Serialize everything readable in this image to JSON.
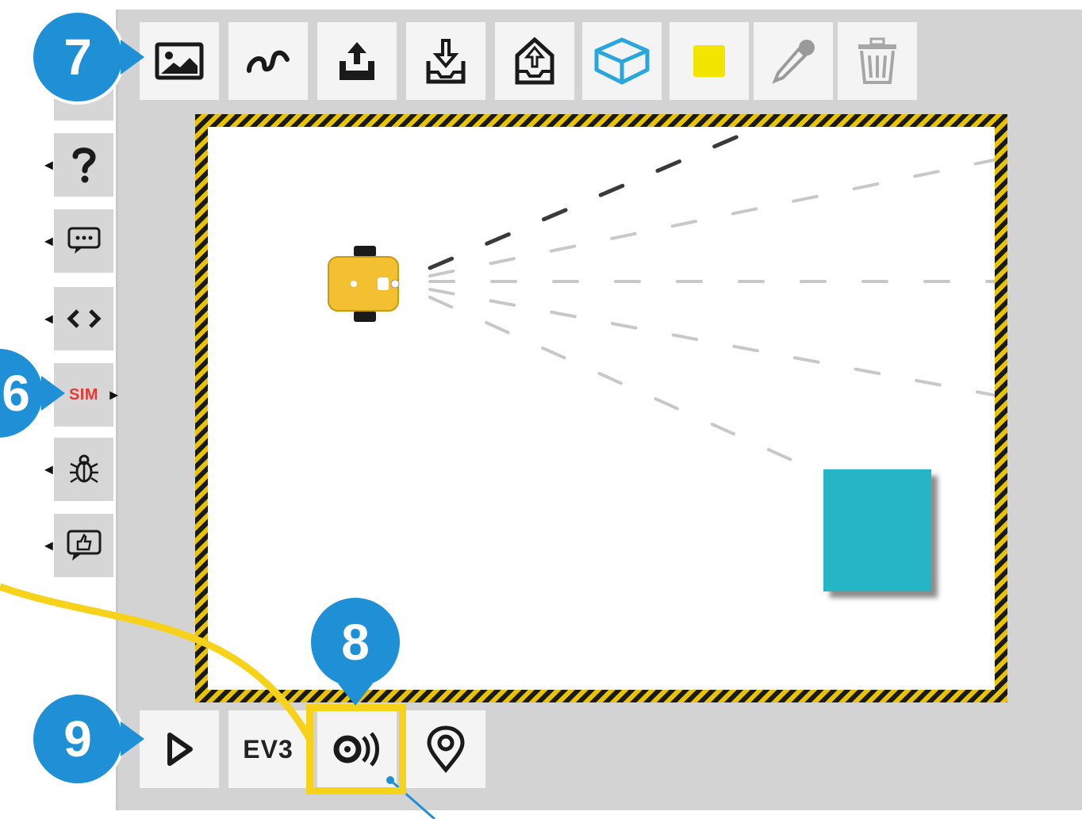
{
  "callouts": {
    "toolbar_number": "7",
    "sim_number": "6",
    "sensor_number": "8",
    "run_number": "9"
  },
  "sidebar": {
    "tabs": [
      {
        "id": "help",
        "icon": "question-icon"
      },
      {
        "id": "messages",
        "icon": "speech-bubble-icon"
      },
      {
        "id": "code",
        "icon": "code-brackets-icon"
      },
      {
        "id": "sim",
        "label": "SIM",
        "active": true
      },
      {
        "id": "debug",
        "icon": "bug-icon"
      },
      {
        "id": "feedback",
        "icon": "thumbs-up-bubble-icon"
      }
    ]
  },
  "toolbar": {
    "items": [
      {
        "id": "background-image",
        "icon": "image-icon"
      },
      {
        "id": "trail",
        "icon": "trail-squiggle-icon"
      },
      {
        "id": "export",
        "icon": "upload-tray-icon"
      },
      {
        "id": "import",
        "icon": "download-tray-icon"
      },
      {
        "id": "upload-scene",
        "icon": "upload-box-icon"
      },
      {
        "id": "add-obstacle",
        "icon": "cube-icon",
        "color": "#29a6dc"
      },
      {
        "id": "color-area",
        "icon": "yellow-square-icon",
        "color": "#f2e600"
      },
      {
        "id": "color-picker",
        "icon": "eyedropper-icon",
        "disabled": true
      },
      {
        "id": "delete",
        "icon": "trash-icon",
        "disabled": true
      }
    ]
  },
  "bottom_bar": {
    "items": [
      {
        "id": "run",
        "icon": "play-icon"
      },
      {
        "id": "robot-type",
        "label": "EV3"
      },
      {
        "id": "sensor-values",
        "icon": "sensor-waves-icon"
      },
      {
        "id": "reset-position",
        "icon": "location-pin-icon"
      }
    ]
  },
  "scene": {
    "robot_color": "#f2c030",
    "obstacle_color": "#26b5c6",
    "border_colors": [
      "#1a1a1a",
      "#e8c300"
    ],
    "highlight_color": "#f7d21b",
    "callout_color": "#1f8fd6"
  }
}
